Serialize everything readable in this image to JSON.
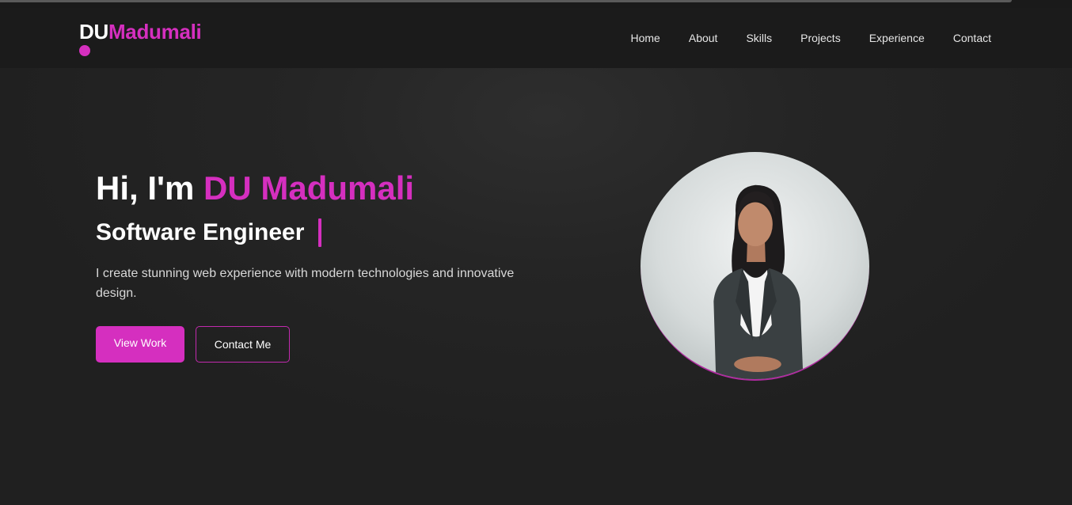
{
  "brand": {
    "prefix": "DU",
    "name": "Madumali",
    "accent_color": "#d52fbf"
  },
  "nav": {
    "items": [
      {
        "label": "Home"
      },
      {
        "label": "About"
      },
      {
        "label": "Skills"
      },
      {
        "label": "Projects"
      },
      {
        "label": "Experience"
      },
      {
        "label": "Contact"
      }
    ]
  },
  "hero": {
    "greeting": "Hi, I'm ",
    "name": "DU Madumali",
    "role": "Software Engineer",
    "description": "I create stunning web experience with modern technologies and innovative design.",
    "primary_button": "View Work",
    "secondary_button": "Contact Me",
    "avatar_icon": "profile-photo"
  }
}
